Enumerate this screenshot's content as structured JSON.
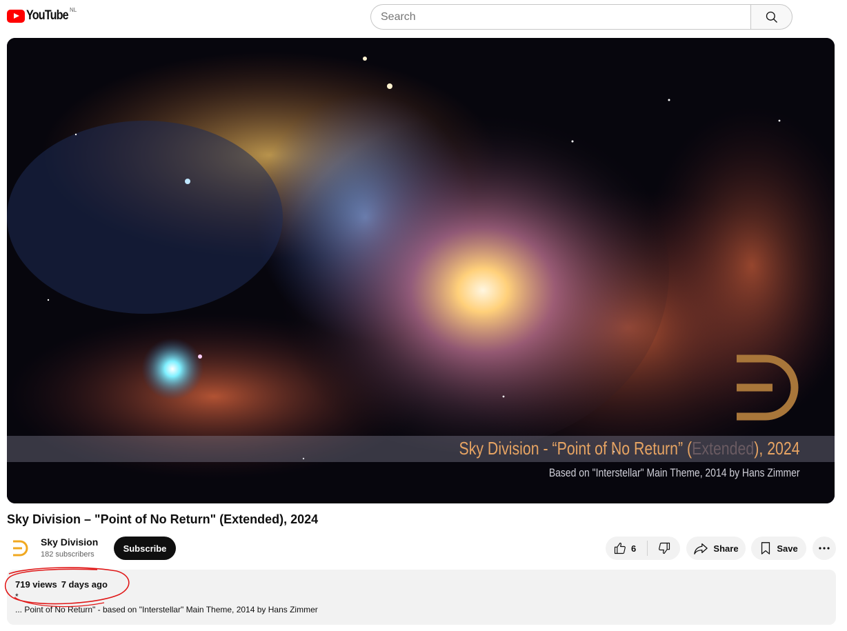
{
  "header": {
    "logo_text": "YouTube",
    "region": "NL",
    "search_placeholder": "Search"
  },
  "player": {
    "overlay_title_a": "Sky Division - “Point of No Return” (",
    "overlay_title_dim": "Extended",
    "overlay_title_b": "), 2024",
    "overlay_subtitle": "Based on \"Interstellar\" Main Theme, 2014 by Hans Zimmer"
  },
  "video": {
    "title": "Sky Division – \"Point of No Return\" (Extended), 2024"
  },
  "channel": {
    "name": "Sky Division",
    "subscribers": "182 subscribers",
    "subscribe_label": "Subscribe"
  },
  "actions": {
    "like_count": "6",
    "share_label": "Share",
    "save_label": "Save"
  },
  "description": {
    "views": "719 views",
    "date": "7 days ago",
    "line1": "*",
    "line2": "... Point of No Return\" - based on \"Interstellar\" Main Theme, 2014 by Hans Zimmer"
  },
  "colors": {
    "brand_red": "#ff0000",
    "accent_orange": "#e7a463",
    "annotation_red": "#e01818"
  },
  "icons": [
    "youtube-play-icon",
    "search-icon",
    "thumbs-up-icon",
    "thumbs-down-icon",
    "share-arrow-icon",
    "bookmark-icon",
    "more-dots-icon",
    "channel-logo-icon"
  ]
}
